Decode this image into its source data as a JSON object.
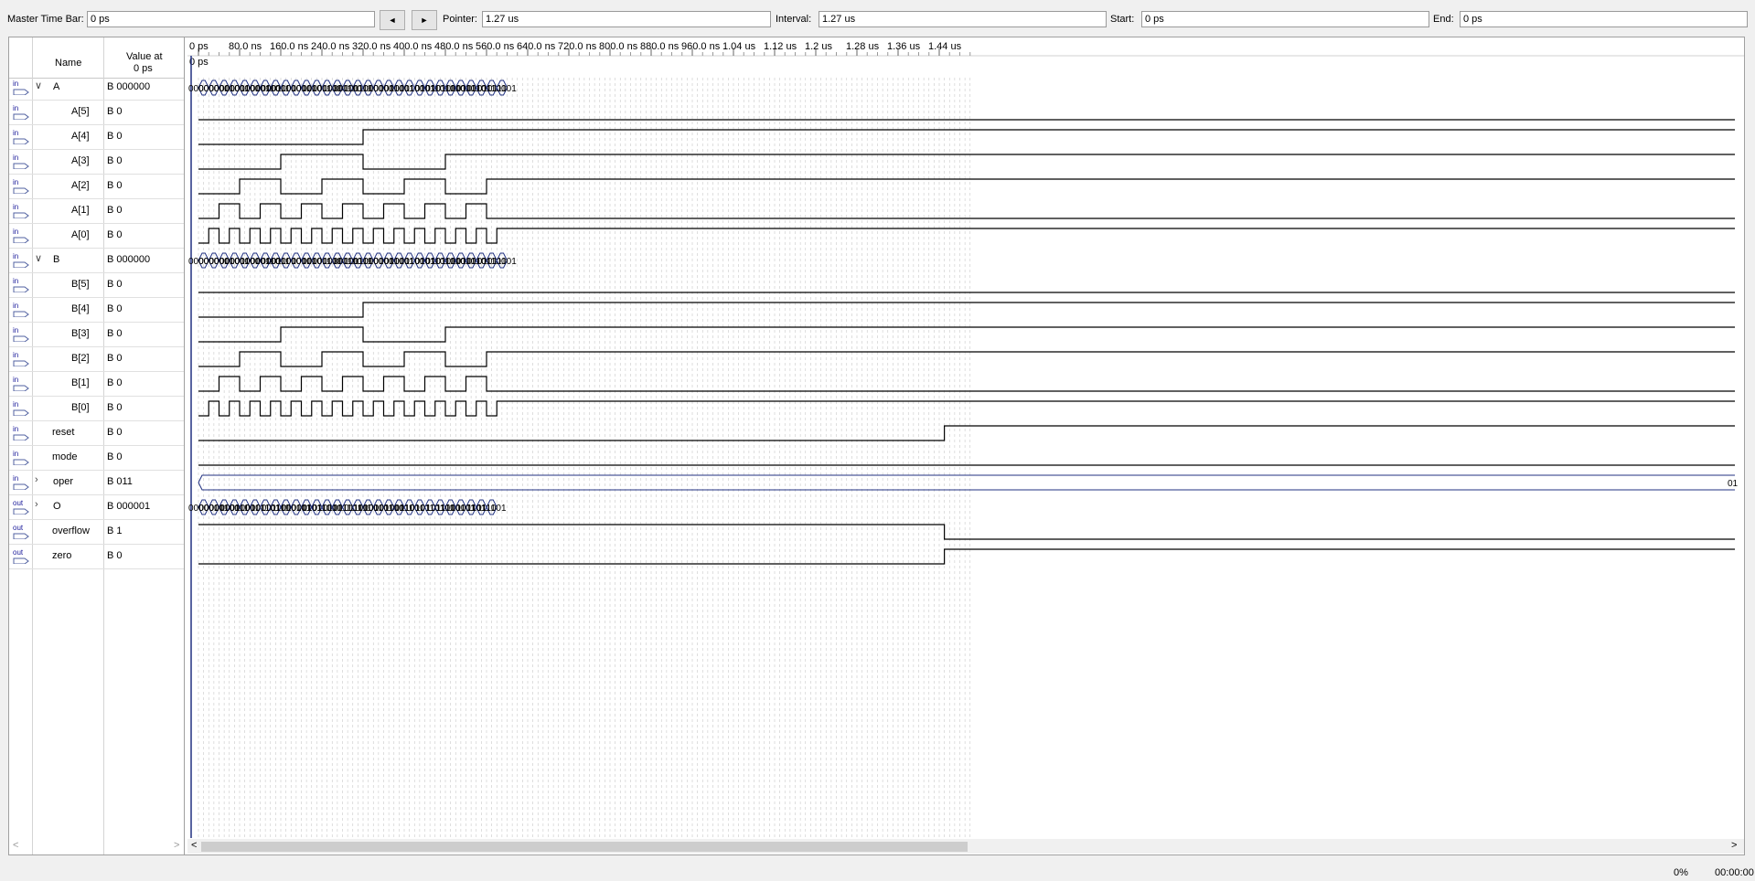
{
  "toolbar": {
    "master_label": "Master Time Bar:",
    "master_value": "0 ps",
    "prev_icon": "◄",
    "next_icon": "►",
    "pointer_label": "Pointer:",
    "pointer_value": "1.27 us",
    "interval_label": "Interval:",
    "interval_value": "1.27 us",
    "start_label": "Start:",
    "start_value": "0 ps",
    "end_label": "End:",
    "end_value": "0 ps"
  },
  "header": {
    "name": "Name",
    "value_line1": "Value at",
    "value_line2": "0 ps"
  },
  "ruler": {
    "labels": [
      "0 ps",
      "80.0 ns",
      "160.0 ns",
      "240.0 ns",
      "320.0 ns",
      "400.0 ns",
      "480.0 ns",
      "560.0 ns",
      "640.0 ns",
      "720.0 ns",
      "800.0 ns",
      "880.0 ns",
      "960.0 ns",
      "1.04 us",
      "1.12 us",
      "1.2 us",
      "1.28 us",
      "1.36 us",
      "1.44 us"
    ],
    "cursor_label": "0 ps"
  },
  "signals": [
    {
      "name": "A",
      "value": "B 000000",
      "dir": "in",
      "group": true
    },
    {
      "name": "A[5]",
      "value": "B 0",
      "dir": "in"
    },
    {
      "name": "A[4]",
      "value": "B 0",
      "dir": "in"
    },
    {
      "name": "A[3]",
      "value": "B 0",
      "dir": "in"
    },
    {
      "name": "A[2]",
      "value": "B 0",
      "dir": "in"
    },
    {
      "name": "A[1]",
      "value": "B 0",
      "dir": "in"
    },
    {
      "name": "A[0]",
      "value": "B 0",
      "dir": "in"
    },
    {
      "name": "B",
      "value": "B 000000",
      "dir": "in",
      "group": true
    },
    {
      "name": "B[5]",
      "value": "B 0",
      "dir": "in"
    },
    {
      "name": "B[4]",
      "value": "B 0",
      "dir": "in"
    },
    {
      "name": "B[3]",
      "value": "B 0",
      "dir": "in"
    },
    {
      "name": "B[2]",
      "value": "B 0",
      "dir": "in"
    },
    {
      "name": "B[1]",
      "value": "B 0",
      "dir": "in"
    },
    {
      "name": "B[0]",
      "value": "B 0",
      "dir": "in"
    },
    {
      "name": "reset",
      "value": "B 0",
      "dir": "in"
    },
    {
      "name": "mode",
      "value": "B 0",
      "dir": "in"
    },
    {
      "name": "oper",
      "value": "B 011",
      "dir": "in",
      "group": true,
      "collapsed": true
    },
    {
      "name": "O",
      "value": "B 000001",
      "dir": "out",
      "group": true,
      "collapsed": true
    },
    {
      "name": "overflow",
      "value": "B 1",
      "dir": "out"
    },
    {
      "name": "zero",
      "value": "B 0",
      "dir": "out"
    }
  ],
  "bus_values": {
    "A": [
      "000000",
      "000001",
      "000010",
      "000011",
      "000100",
      "000101",
      "000110",
      "000111",
      "001000",
      "001001",
      "001010",
      "001011",
      "001100",
      "001101",
      "001110",
      "001111",
      "010000",
      "010001",
      "010010",
      "010011",
      "010100",
      "010101",
      "010110",
      "010111",
      "011000",
      "011001",
      "011010",
      "011011",
      "011100",
      "011101"
    ],
    "B": [
      "000000",
      "000001",
      "000010",
      "000011",
      "000100",
      "000101",
      "000110",
      "000111",
      "001000",
      "001001",
      "001010",
      "001011",
      "001100",
      "001101",
      "001110",
      "001111",
      "010000",
      "010001",
      "010010",
      "010011",
      "010100",
      "010101",
      "010110",
      "010111",
      "011000",
      "011001",
      "011010",
      "011011",
      "011100",
      "011101"
    ],
    "O": [
      "000001",
      "000011",
      "000101",
      "000111",
      "001001",
      "001011",
      "001101",
      "001111",
      "010001",
      "010011",
      "010101",
      "010111",
      "011001",
      "011011",
      "011101",
      "011111",
      "100001",
      "100011",
      "100101",
      "100111",
      "101001",
      "101011",
      "101101",
      "101111",
      "110001",
      "110011",
      "110101",
      "110111",
      "111001"
    ],
    "oper_tail": "01"
  },
  "status": {
    "percent": "0%",
    "time": "00:00:00"
  },
  "scroll": {
    "left_arrow": "<",
    "right_arrow": ">"
  }
}
